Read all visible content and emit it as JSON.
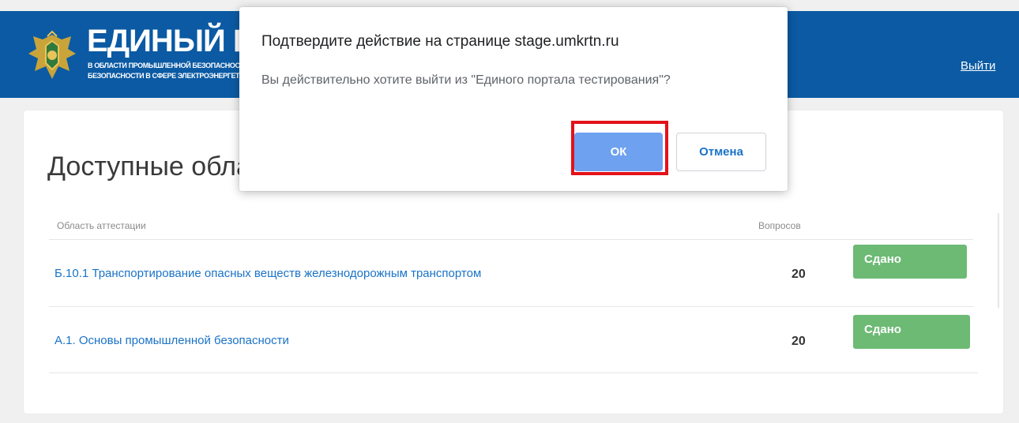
{
  "header": {
    "brand_title": "ЕДИНЫЙ ПОРТАЛ ТЕСТИРОВАНИЯ",
    "brand_sub_line1": "В ОБЛАСТИ ПРОМЫШЛЕННОЙ БЕЗОПАСНОСТИ,",
    "brand_sub_line2": "БЕЗОПАСНОСТИ В СФЕРЕ ЭЛЕКТРОЭНЕРГЕТИКИ",
    "logout_label": "Выйти",
    "bg_color": "#0b5aa3"
  },
  "main": {
    "title": "Доступные области аттестации",
    "table": {
      "headers": {
        "area": "Область аттестации",
        "questions": "Вопросов"
      },
      "rows": [
        {
          "area": "Б.10.1 Транспортирование опасных веществ железнодорожным транспортом",
          "questions": "20",
          "status": "Сдано"
        },
        {
          "area": "А.1. Основы промышленной безопасности",
          "questions": "20",
          "status": "Сдано"
        }
      ]
    },
    "status_color": "#6cba74",
    "link_color": "#1a73c7"
  },
  "dialog": {
    "title": "Подтвердите действие на странице stage.umkrtn.ru",
    "message": "Вы действительно хотите выйти из \"Единого портала тестирования\"?",
    "ok_label": "ОК",
    "cancel_label": "Отмена",
    "ok_color": "#6ea1f0",
    "highlight_color": "#e3121a"
  }
}
